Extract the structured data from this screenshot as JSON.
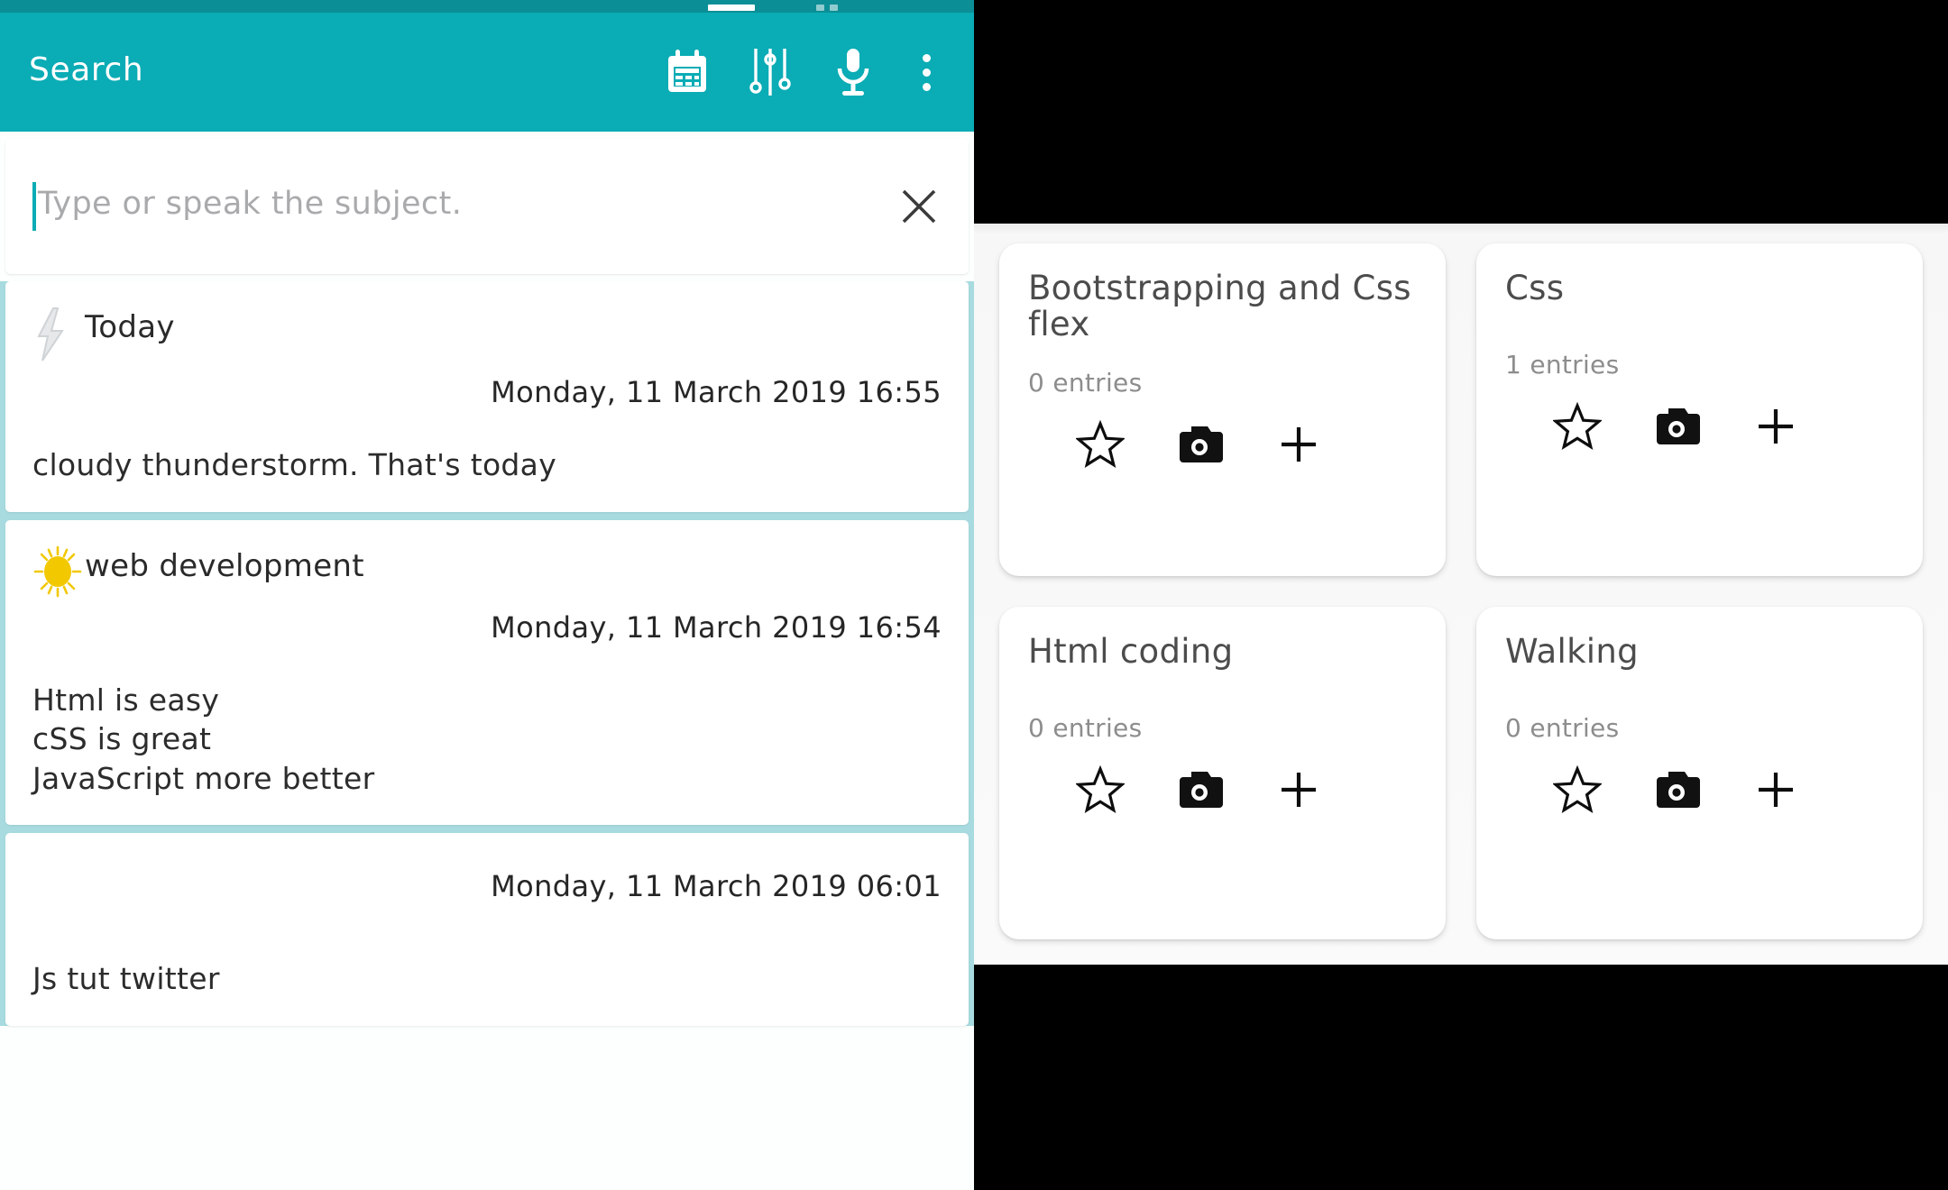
{
  "colors": {
    "app_bar": "#0aacb5",
    "status_bar": "#0b8e96",
    "card_separator": "#a8dbe0",
    "caret": "#0aacb5",
    "right_panel_bg": "#fafafa",
    "outer_bg": "#000000",
    "sun_icon": "#f2c800",
    "bolt_icon": "#e4e6e8"
  },
  "app_bar": {
    "title": "Search",
    "actions": [
      {
        "name": "calendar-icon",
        "label": "Calendar"
      },
      {
        "name": "tuner-icon",
        "label": "Filter settings"
      },
      {
        "name": "microphone-icon",
        "label": "Voice input"
      },
      {
        "name": "overflow-menu-icon",
        "label": "More options"
      }
    ]
  },
  "search": {
    "value": "",
    "placeholder": "Type or speak the subject.",
    "clear_label": "✕"
  },
  "notes": [
    {
      "icon": "thunderstorm-icon",
      "title": "Today",
      "date": "Monday, 11 March 2019 16:55",
      "body": [
        "cloudy thunderstorm. That's today"
      ]
    },
    {
      "icon": "sun-icon",
      "title": "web development",
      "date": "Monday, 11 March 2019 16:54",
      "body": [
        "Html is easy",
        "cSS is great",
        "JavaScript more better"
      ]
    },
    {
      "icon": "",
      "title": "",
      "date": "Monday, 11 March 2019 06:01",
      "body": [
        "Js tut twitter"
      ]
    }
  ],
  "subjects": [
    {
      "title": "Bootstrapping and Css flex",
      "entries": "0 entries",
      "actions": [
        "star-outline-icon",
        "camera-icon",
        "plus-icon"
      ]
    },
    {
      "title": "Css",
      "entries": "1 entries",
      "actions": [
        "star-outline-icon",
        "camera-icon",
        "plus-icon"
      ]
    },
    {
      "title": "Html coding",
      "entries": "0 entries",
      "actions": [
        "star-outline-icon",
        "camera-icon",
        "plus-icon"
      ]
    },
    {
      "title": "Walking",
      "entries": "0 entries",
      "actions": [
        "star-outline-icon",
        "camera-icon",
        "plus-icon"
      ]
    }
  ]
}
